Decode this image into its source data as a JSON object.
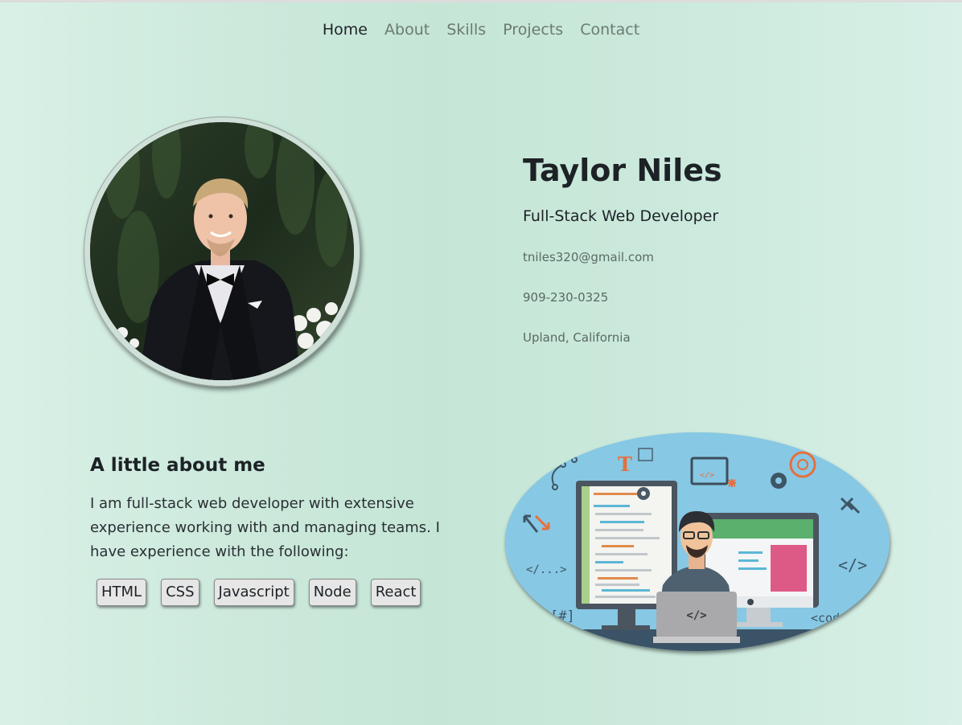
{
  "nav": {
    "items": [
      "Home",
      "About",
      "Skills",
      "Projects",
      "Contact"
    ],
    "active": "Home"
  },
  "profile": {
    "name": "Taylor Niles",
    "title": "Full-Stack Web Developer",
    "email": "tniles320@gmail.com",
    "phone": "909-230-0325",
    "location": "Upland, California"
  },
  "about": {
    "heading": "A little about me",
    "text": "I am full-stack web developer with extensive experience working with and managing teams. I have experience with the following:",
    "skills": [
      "HTML",
      "CSS",
      "Javascript",
      "Node",
      "React"
    ]
  },
  "illustration": {
    "labels": [
      "</...>",
      "[#]",
      "</>",
      "<code>",
      "T",
      "</>"
    ]
  },
  "colors": {
    "accent_orange": "#e76f3c",
    "illustration_bg": "#87c8e4"
  }
}
